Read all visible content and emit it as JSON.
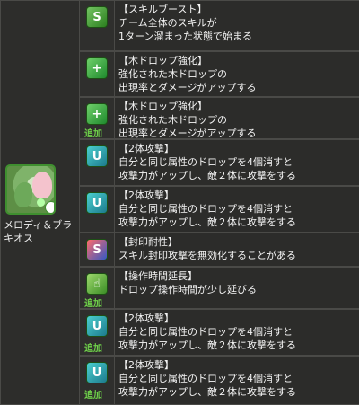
{
  "character": {
    "name_line1": "メロディ＆ブラ",
    "name_line2": "キオス"
  },
  "colors": {
    "background": "#2c2c2a",
    "grid": "#4a4a47",
    "add_label": "#6fd24a"
  },
  "awakenings": [
    {
      "icon": "skill-boost-icon",
      "title": "【スキルブースト】",
      "lines": [
        "チーム全体のスキルが",
        "1ターン溜まった状態で始まる"
      ],
      "add": ""
    },
    {
      "icon": "wood-drop-enhance-icon",
      "title": "【木ドロップ強化】",
      "lines": [
        "強化された木ドロップの",
        "出現率とダメージがアップする"
      ],
      "add": ""
    },
    {
      "icon": "wood-drop-enhance-icon",
      "title": "【木ドロップ強化】",
      "lines": [
        "強化された木ドロップの",
        "出現率とダメージがアップする"
      ],
      "add": "追加"
    },
    {
      "icon": "two-body-attack-icon",
      "title": "【2体攻撃】",
      "lines": [
        "自分と同じ属性のドロップを4個消すと",
        "攻撃力がアップし、敵２体に攻撃をする"
      ],
      "add": ""
    },
    {
      "icon": "two-body-attack-icon",
      "title": "【2体攻撃】",
      "lines": [
        "自分と同じ属性のドロップを4個消すと",
        "攻撃力がアップし、敵２体に攻撃をする"
      ],
      "add": ""
    },
    {
      "icon": "seal-resist-icon",
      "title": "【封印耐性】",
      "lines": [
        "スキル封印攻撃を無効化することがある"
      ],
      "add": ""
    },
    {
      "icon": "time-extend-icon",
      "title": "【操作時間延長】",
      "lines": [
        "ドロップ操作時間が少し延びる"
      ],
      "add": "追加"
    },
    {
      "icon": "two-body-attack-icon",
      "title": "【2体攻撃】",
      "lines": [
        "自分と同じ属性のドロップを4個消すと",
        "攻撃力がアップし、敵２体に攻撃をする"
      ],
      "add": "追加"
    },
    {
      "icon": "two-body-attack-icon",
      "title": "【2体攻撃】",
      "lines": [
        "自分と同じ属性のドロップを4個消すと",
        "攻撃力がアップし、敵２体に攻撃をする"
      ],
      "add": "追加"
    }
  ]
}
